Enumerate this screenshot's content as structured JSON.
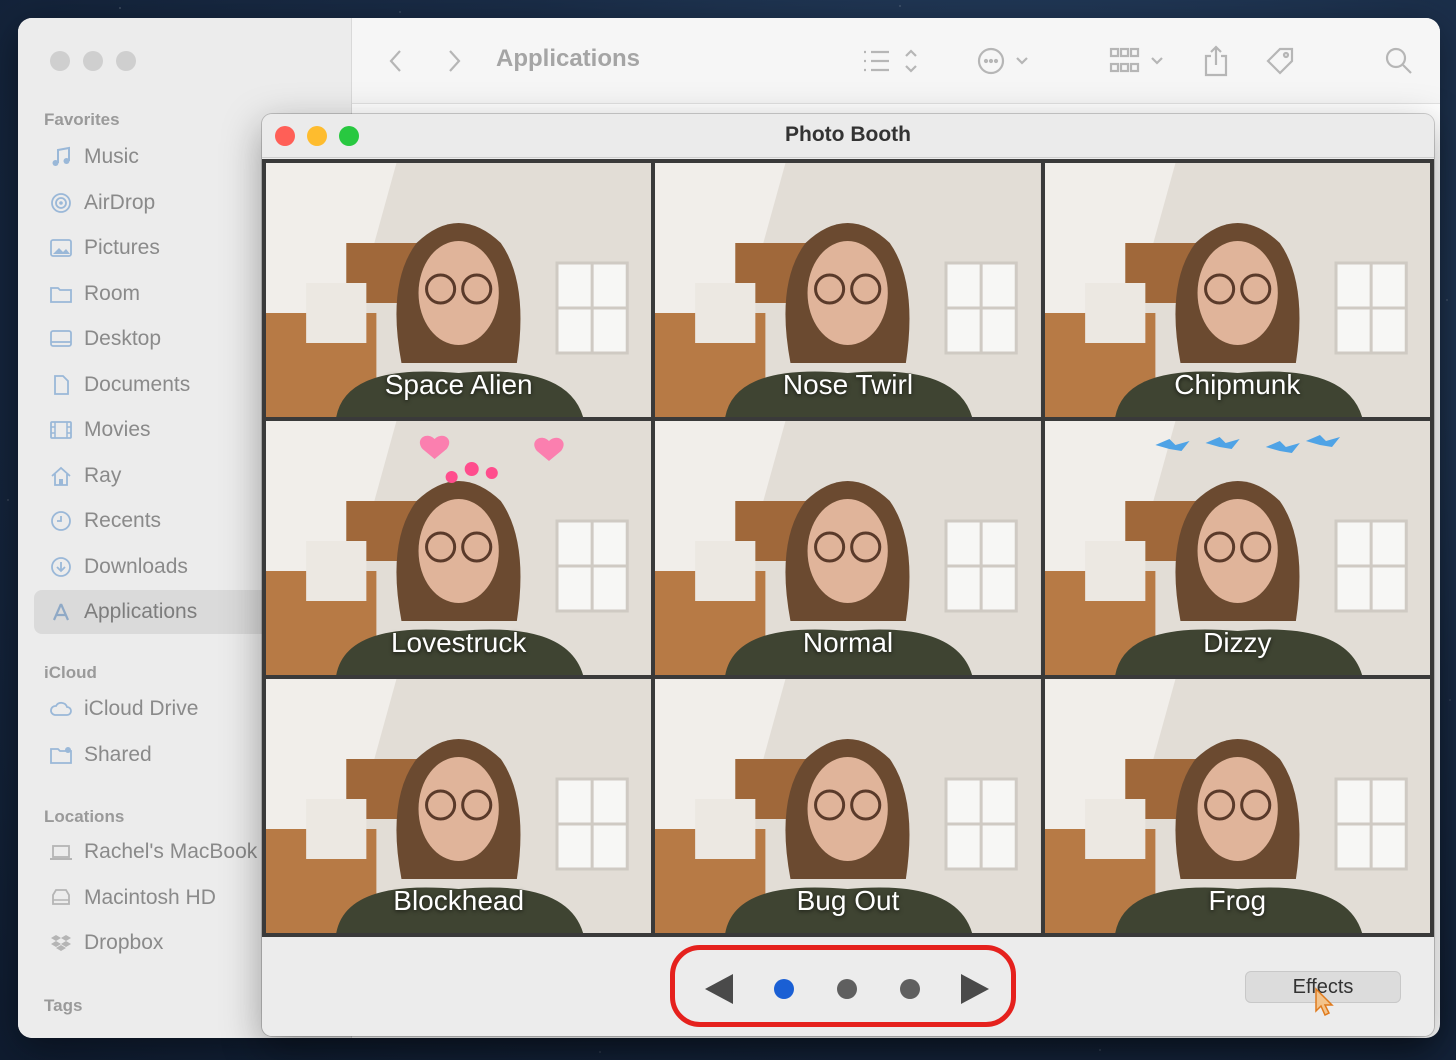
{
  "finder": {
    "toolbar_title": "Applications",
    "favorites_heading": "Favorites",
    "favorites": [
      {
        "label": "Music",
        "icon": "music-note-icon"
      },
      {
        "label": "AirDrop",
        "icon": "airdrop-icon"
      },
      {
        "label": "Pictures",
        "icon": "pictures-icon"
      },
      {
        "label": "Room",
        "icon": "folder-icon"
      },
      {
        "label": "Desktop",
        "icon": "desktop-icon"
      },
      {
        "label": "Documents",
        "icon": "document-icon"
      },
      {
        "label": "Movies",
        "icon": "film-icon"
      },
      {
        "label": "Ray",
        "icon": "home-icon"
      },
      {
        "label": "Recents",
        "icon": "clock-icon"
      },
      {
        "label": "Downloads",
        "icon": "download-icon"
      },
      {
        "label": "Applications",
        "icon": "applications-icon",
        "selected": true
      }
    ],
    "icloud_heading": "iCloud",
    "icloud": [
      {
        "label": "iCloud Drive",
        "icon": "cloud-icon"
      },
      {
        "label": "Shared",
        "icon": "shared-folder-icon"
      }
    ],
    "locations_heading": "Locations",
    "locations": [
      {
        "label": "Rachel's MacBook",
        "icon": "laptop-icon"
      },
      {
        "label": "Macintosh HD",
        "icon": "disk-icon"
      },
      {
        "label": "Dropbox",
        "icon": "dropbox-icon"
      }
    ],
    "tags_heading": "Tags"
  },
  "photo_booth": {
    "title": "Photo Booth",
    "effects": [
      {
        "label": "Space Alien"
      },
      {
        "label": "Nose Twirl"
      },
      {
        "label": "Chipmunk"
      },
      {
        "label": "Lovestruck",
        "overlay": "hearts"
      },
      {
        "label": "Normal"
      },
      {
        "label": "Dizzy",
        "overlay": "birds"
      },
      {
        "label": "Blockhead"
      },
      {
        "label": "Bug Out"
      },
      {
        "label": "Frog"
      }
    ],
    "pager": {
      "pages": 3,
      "current_page": 1,
      "active_color": "#1a5fd4",
      "highlight_color": "#e5211d"
    },
    "effects_button_label": "Effects"
  },
  "colors": {
    "close": "#ff5f57",
    "minimize": "#febc2e",
    "zoom": "#28c840"
  }
}
